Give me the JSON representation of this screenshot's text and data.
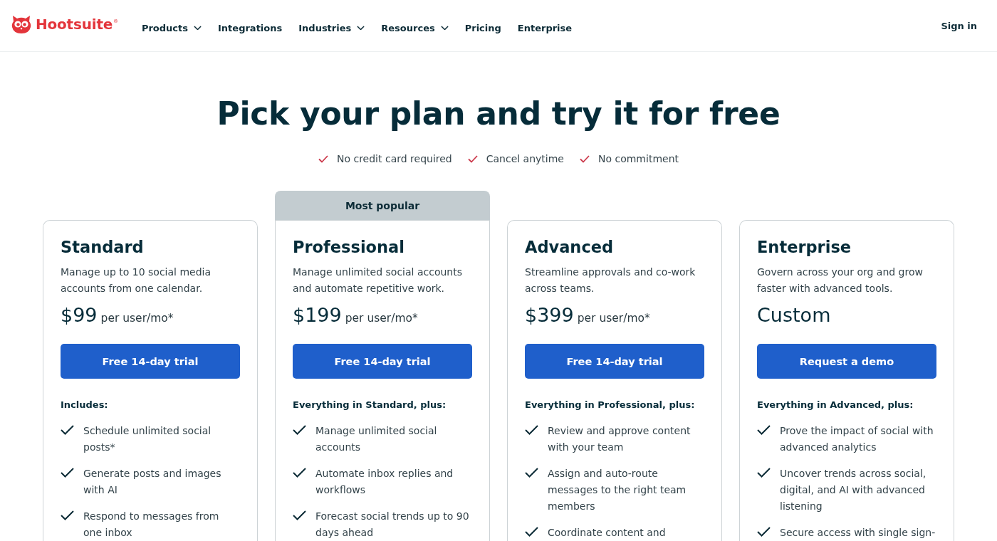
{
  "header": {
    "logo": "Hootsuite$^{®}$",
    "nav": [
      {
        "label": "Products",
        "has_menu": true
      },
      {
        "label": "Integrations",
        "has_menu": false
      },
      {
        "label": "Industries",
        "has_menu": true
      },
      {
        "label": "Resources",
        "has_menu": true
      },
      {
        "label": "Pricing",
        "has_menu": false
      },
      {
        "label": "Enterprise",
        "has_menu": false
      }
    ],
    "sign_in": "Sign in"
  },
  "hero": {
    "title": "Pick your plan and try it for free",
    "perks": [
      "No credit card required",
      "Cancel anytime",
      "No commitment"
    ]
  },
  "plans": [
    {
      "name": "Standard",
      "description": "Manage up to 10 social media accounts from one calendar.",
      "price": "$99",
      "price_unit": "per user/mo*",
      "button": "Free 14-day trial",
      "features_heading": "Includes:",
      "features": [
        "Schedule unlimited social posts*",
        "Generate posts and images with AI",
        "Respond to messages from one inbox"
      ]
    },
    {
      "name": "Professional",
      "badge": "Most popular",
      "description": "Manage unlimited social accounts and automate repetitive work.",
      "price": "$199",
      "price_unit": "per user/mo*",
      "button": "Free 14-day trial",
      "features_heading": "Everything in Standard, plus:",
      "features": [
        "Manage unlimited social accounts",
        "Automate inbox replies and workflows",
        "Forecast social trends up to 90 days ahead"
      ]
    },
    {
      "name": "Advanced",
      "description": "Streamline approvals and co-work across teams.",
      "price": "$399",
      "price_unit": "per user/mo*",
      "button": "Free 14-day trial",
      "features_heading": "Everything in Professional, plus:",
      "features": [
        "Review and approve content with your team",
        "Assign and auto-route messages to the right team members",
        "Coordinate content and"
      ]
    },
    {
      "name": "Enterprise",
      "description": "Govern across your org and grow faster with advanced tools.",
      "price": "Custom",
      "button": "Request a demo",
      "features_heading": "Everything in Advanced, plus:",
      "features": [
        "Prove the impact of social with advanced analytics",
        "Uncover trends across social, digital, and AI with advanced listening",
        "Secure access with single sign-"
      ]
    }
  ]
}
